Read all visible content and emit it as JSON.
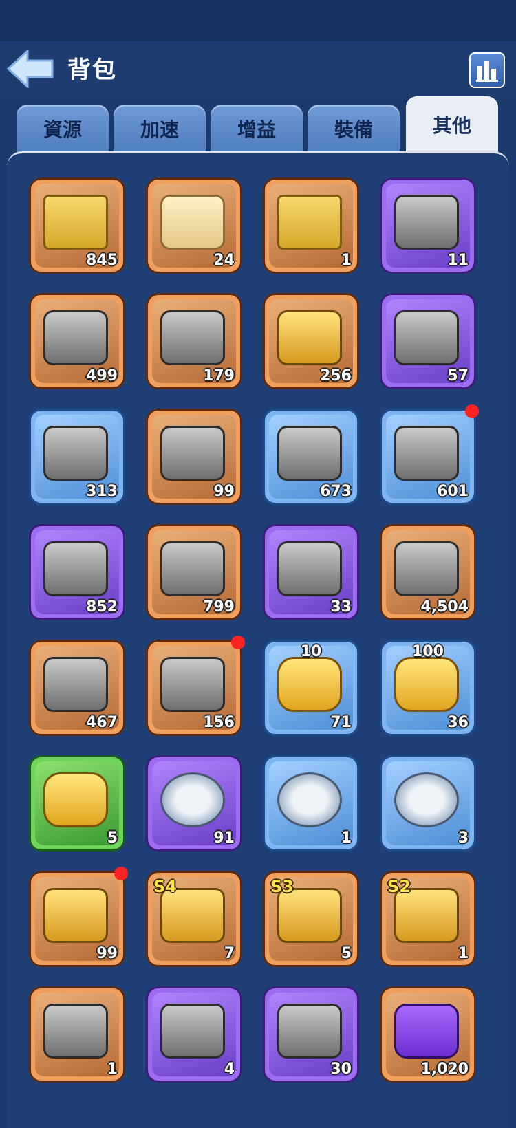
{
  "header": {
    "title": "背包"
  },
  "tabs": [
    {
      "label": "資源",
      "active": false
    },
    {
      "label": "加速",
      "active": false
    },
    {
      "label": "增益",
      "active": false
    },
    {
      "label": "裝備",
      "active": false
    },
    {
      "label": "其他",
      "active": true
    }
  ],
  "items": [
    {
      "icon": "golden-trophy-ticket-icon",
      "count": "845",
      "rarity": "orange"
    },
    {
      "icon": "scroll-decree-icon",
      "count": "24",
      "rarity": "orange"
    },
    {
      "icon": "30-ticket-icon",
      "count": "1",
      "rarity": "orange"
    },
    {
      "icon": "relocation-compass-icon",
      "count": "11",
      "rarity": "purple"
    },
    {
      "icon": "mystery-chest-equipment-icon",
      "count": "499",
      "rarity": "orange"
    },
    {
      "icon": "mystery-chest-cards-icon",
      "count": "179",
      "rarity": "orange"
    },
    {
      "icon": "golden-mystery-chest-icon",
      "count": "256",
      "rarity": "orange"
    },
    {
      "icon": "mystery-chest-purple-icon",
      "count": "57",
      "rarity": "purple"
    },
    {
      "icon": "mystery-chest-icon",
      "count": "313",
      "rarity": "blue"
    },
    {
      "icon": "supply-pack-icon",
      "count": "99",
      "rarity": "orange"
    },
    {
      "icon": "skull-sack-icon",
      "count": "673",
      "rarity": "blue"
    },
    {
      "icon": "loot-sack-icon",
      "count": "601",
      "rarity": "blue",
      "dot": true
    },
    {
      "icon": "bronze-chest-purple-icon",
      "count": "852",
      "rarity": "purple"
    },
    {
      "icon": "bronze-chest-icon",
      "count": "799",
      "rarity": "orange"
    },
    {
      "icon": "purple-mystery-chest-icon",
      "count": "33",
      "rarity": "purple"
    },
    {
      "icon": "war-chest-icon",
      "count": "4,504",
      "rarity": "orange"
    },
    {
      "icon": "spartan-chest-icon",
      "count": "467",
      "rarity": "orange"
    },
    {
      "icon": "spiked-chest-icon",
      "count": "156",
      "rarity": "orange",
      "dot": true
    },
    {
      "icon": "vip-hex-10-icon",
      "count": "71",
      "rarity": "blue",
      "top": "10"
    },
    {
      "icon": "vip-hex-100-icon",
      "count": "36",
      "rarity": "blue",
      "top": "100"
    },
    {
      "icon": "vip-hex-timed-icon",
      "count": "5",
      "rarity": "green"
    },
    {
      "icon": "tower-expansion-icon",
      "count": "91",
      "rarity": "purple"
    },
    {
      "icon": "castle-expansion-icon",
      "count": "1",
      "rarity": "blue"
    },
    {
      "icon": "banner-expansion-icon",
      "count": "3",
      "rarity": "blue"
    },
    {
      "icon": "treasure-chest-paw-icon",
      "count": "99",
      "rarity": "orange",
      "dot": true
    },
    {
      "icon": "season-chest-s4-icon",
      "count": "7",
      "rarity": "orange",
      "season": "S4"
    },
    {
      "icon": "season-chest-s3-icon",
      "count": "5",
      "rarity": "orange",
      "season": "S3"
    },
    {
      "icon": "season-chest-s2-icon",
      "count": "1",
      "rarity": "orange",
      "season": "S2"
    },
    {
      "icon": "royal-chest-icon",
      "count": "1",
      "rarity": "orange"
    },
    {
      "icon": "royal-chest-purple-icon",
      "count": "4",
      "rarity": "purple"
    },
    {
      "icon": "puzzle-chest-icon",
      "count": "30",
      "rarity": "purple"
    },
    {
      "icon": "purple-crest-icon",
      "count": "1,020",
      "rarity": "orange"
    }
  ]
}
